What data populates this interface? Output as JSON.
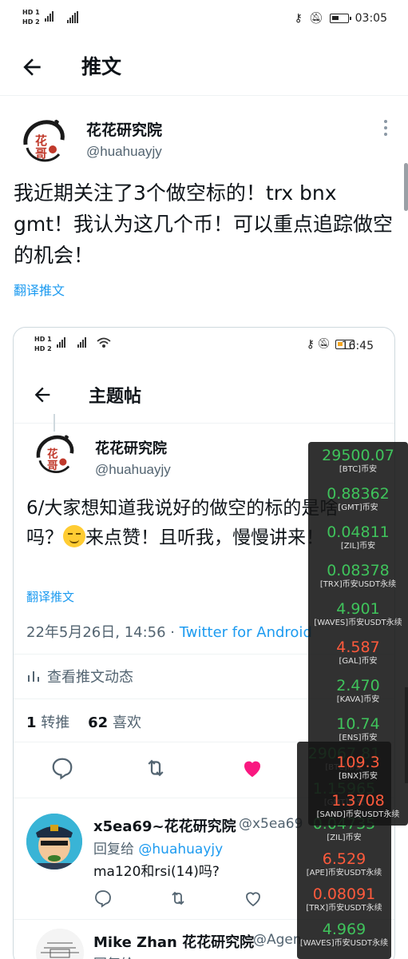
{
  "status_bar": {
    "sim1": "HD 1",
    "sim2": "HD 2",
    "net1": "4G",
    "net2": "4G",
    "time": "03:05"
  },
  "header": {
    "title": "推文"
  },
  "tweet": {
    "author_name": "花花研究院",
    "author_handle": "@huahuayjy",
    "text": "我近期关注了3个做空标的！trx bnx gmt！我认为这几个币！可以重点追踪做空的机会！",
    "translate": "翻译推文"
  },
  "embedded": {
    "status_time": "16:45",
    "header_title": "主题帖",
    "author_name": "花花研究院",
    "author_handle": "@huahuayjy",
    "text_part1": "6/大家想知道我说好的做空的标的是啥吗？",
    "text_part2": "来点赞！且听我，慢慢讲来！",
    "translate": "翻译推文",
    "date": "22年5月26日, 14:56 · ",
    "source": "Twitter for Android",
    "activity": "查看推文动态",
    "retweets_count": "1",
    "retweets_label": "转推",
    "likes_count": "62",
    "likes_label": "喜欢",
    "reply1": {
      "name": "x5ea69~花花研究院",
      "handle": "@x5ea69",
      "reply_to_prefix": "回复给 ",
      "reply_to": "@huahuayjy",
      "text": "ma120和rsi(14)吗?"
    },
    "reply2": {
      "name": "Mike Zhan 花花研究院",
      "handle": "@Agen",
      "reply_to_prefix": "回复给 "
    }
  },
  "ticker_primary": [
    {
      "price": "29500.07",
      "label": "[BTC]币安",
      "trend": "up"
    },
    {
      "price": "0.88362",
      "label": "[GMT]币安",
      "trend": "up"
    },
    {
      "price": "0.04811",
      "label": "[ZIL]币安",
      "trend": "up"
    },
    {
      "price": "0.08378",
      "label": "[TRX]币安USDT永续",
      "trend": "up"
    },
    {
      "price": "4.901",
      "label": "[WAVES]币安USDT永续",
      "trend": "up"
    },
    {
      "price": "4.587",
      "label": "[GAL]币安",
      "trend": "down"
    },
    {
      "price": "2.470",
      "label": "[KAVA]币安",
      "trend": "up"
    },
    {
      "price": "10.74",
      "label": "[ENS]币安",
      "trend": "up"
    },
    {
      "price": "109.3",
      "label": "[BNX]币安",
      "trend": "down"
    },
    {
      "price": "1.3708",
      "label": "[SAND]币安USDT永续",
      "trend": "down"
    }
  ],
  "ticker_secondary": [
    {
      "price": "29067.81",
      "label": "[BTC]币安",
      "trend": "up"
    },
    {
      "price": "1.15965",
      "label": "[GMT]币安",
      "trend": "up"
    },
    {
      "price": "0.04735",
      "label": "[ZIL]币安",
      "trend": "up"
    },
    {
      "price": "6.529",
      "label": "[APE]币安USDT永续",
      "trend": "down"
    },
    {
      "price": "0.08091",
      "label": "[TRX]币安USDT永续",
      "trend": "down"
    },
    {
      "price": "4.969",
      "label": "[WAVES]币安USDT永续",
      "trend": "up"
    }
  ]
}
